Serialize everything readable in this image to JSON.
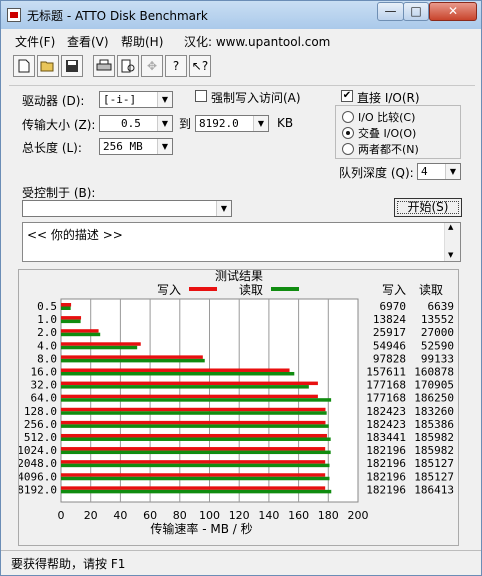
{
  "window": {
    "title": "无标题 - ATTO Disk Benchmark",
    "buttons": {
      "minimize": "—",
      "maximize": "□",
      "close": "✕"
    }
  },
  "menu": [
    "文件(F)",
    "查看(V)",
    "帮助(H)",
    "汉化: www.upantool.com"
  ],
  "toolbar": [
    "new-icon",
    "open-icon",
    "save-icon",
    "print-icon",
    "print-preview-icon",
    "move-icon",
    "help-icon",
    "context-help-icon"
  ],
  "settings": {
    "drive_label": "驱动器 (D):",
    "drive_value": "[-i-]",
    "force_write_label": "强制写入访问(A)",
    "direct_io_label": "直接 I/O(R)",
    "direct_io_checked": true,
    "transfer_label": "传输大小 (Z):",
    "transfer_from": "0.5",
    "to_label": "到",
    "transfer_to": "8192.0",
    "kb_label": "KB",
    "total_label": "总长度 (L):",
    "total_value": "256 MB",
    "io_options": [
      "I/O 比较(C)",
      "交叠 I/O(O)",
      "两者都不(N)"
    ],
    "io_selected": 1,
    "queue_label": "队列深度 (Q):",
    "queue_value": "4",
    "controlled_label": "受控制于 (B):",
    "controlled_value": "",
    "start_button": "开始(S)",
    "description": "<<  你的描述   >>"
  },
  "results": {
    "title": "测试结果",
    "legend_write": "写入",
    "legend_read": "读取",
    "col_write": "写入",
    "col_read": "读取",
    "colors": {
      "write": "#e81010",
      "read": "#108c10"
    }
  },
  "chart_data": {
    "type": "bar",
    "title": "测试结果",
    "xlabel": "传输速率 - MB / 秒",
    "xlim": [
      0,
      200
    ],
    "xticks": [
      0,
      20,
      40,
      60,
      80,
      100,
      120,
      140,
      160,
      180,
      200
    ],
    "categories": [
      "0.5",
      "1.0",
      "2.0",
      "4.0",
      "8.0",
      "16.0",
      "32.0",
      "64.0",
      "128.0",
      "256.0",
      "512.0",
      "1024.0",
      "2048.0",
      "4096.0",
      "8192.0"
    ],
    "series": [
      {
        "name": "写入",
        "values": [
          6.8,
          13.5,
          25.3,
          53.7,
          95.5,
          153.9,
          173.0,
          173.0,
          178.1,
          178.1,
          179.1,
          177.9,
          177.9,
          177.9,
          177.9
        ]
      },
      {
        "name": "读取",
        "values": [
          6.5,
          13.2,
          26.4,
          51.3,
          96.8,
          157.1,
          166.9,
          181.9,
          178.9,
          180.3,
          181.6,
          181.6,
          180.8,
          180.8,
          182.0
        ]
      }
    ],
    "write_values": [
      "6970",
      "13824",
      "25917",
      "54946",
      "97828",
      "157611",
      "177168",
      "177168",
      "182423",
      "182423",
      "183441",
      "182196",
      "182196",
      "182196",
      "182196"
    ],
    "read_values": [
      "6639",
      "13552",
      "27000",
      "52590",
      "99133",
      "160878",
      "170905",
      "186250",
      "183260",
      "185386",
      "185982",
      "185982",
      "185127",
      "185127",
      "186413"
    ]
  },
  "status": "要获得帮助，请按 F1"
}
